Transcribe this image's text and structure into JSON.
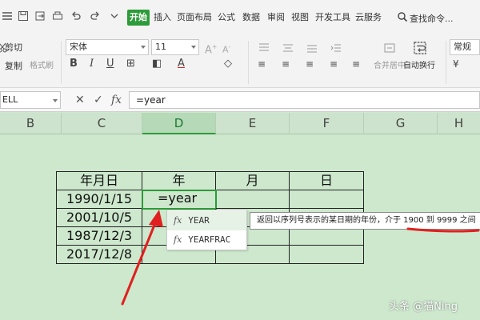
{
  "menubar": {
    "items": [
      {
        "label": "开始",
        "active": true
      },
      {
        "label": "插入"
      },
      {
        "label": "页面布局"
      },
      {
        "label": "公式"
      },
      {
        "label": "数据"
      },
      {
        "label": "审阅"
      },
      {
        "label": "视图"
      },
      {
        "label": "开发工具"
      },
      {
        "label": "云服务"
      }
    ],
    "search_label": "查找命令..."
  },
  "ribbon": {
    "cut_label": "剪切",
    "copy_label": "复制",
    "format_painter_label": "格式刷",
    "font_name": "宋体",
    "font_size": "11",
    "merge_center_label": "合并居中",
    "wrap_text_label": "自动换行",
    "number_format": "常规"
  },
  "formula_bar": {
    "name_box": "ELL",
    "cancel_symbol": "✕",
    "confirm_symbol": "✓",
    "fx_label": "fx",
    "formula": "=year"
  },
  "columns": [
    "B",
    "C",
    "D",
    "E",
    "F",
    "G",
    "H"
  ],
  "active_column": "D",
  "table": {
    "headers": [
      "年月日",
      "年",
      "月",
      "日"
    ],
    "rows": [
      [
        "1990/1/15",
        "=year",
        "",
        ""
      ],
      [
        "2001/10/5",
        "",
        "",
        ""
      ],
      [
        "1987/12/3",
        "",
        "",
        ""
      ],
      [
        "2017/12/8",
        "",
        "",
        ""
      ]
    ]
  },
  "autocomplete": {
    "items": [
      {
        "icon": "fx",
        "label": "YEAR"
      },
      {
        "icon": "fx",
        "label": "YEARFRAC"
      }
    ]
  },
  "tooltip": "返回以序列号表示的某日期的年份，介于 1900 到 9999 之间",
  "annotation_color": "#e02020",
  "accent_color": "#2e9b3a",
  "watermark": "头条 @猫Ning"
}
